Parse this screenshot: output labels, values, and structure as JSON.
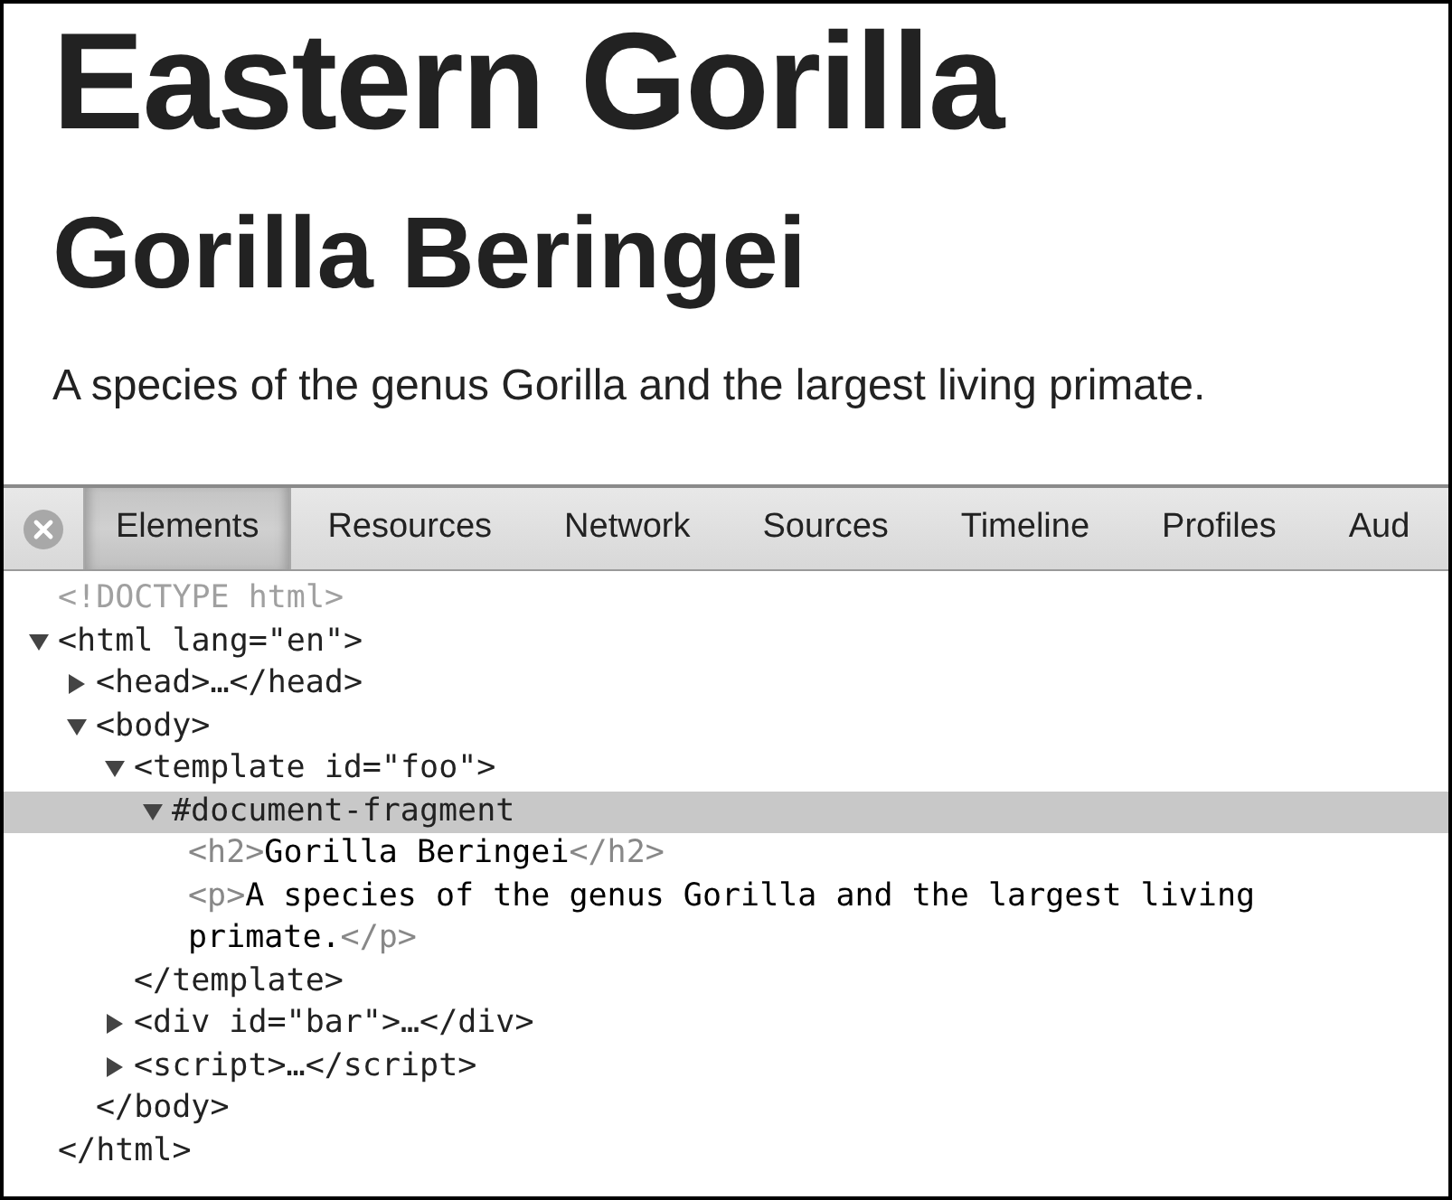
{
  "page": {
    "heading": "Eastern Gorilla",
    "subheading": "Gorilla Beringei",
    "paragraph": "A species of the genus Gorilla and the largest living primate."
  },
  "devtools": {
    "tabs": [
      {
        "label": "Elements",
        "selected": true
      },
      {
        "label": "Resources",
        "selected": false
      },
      {
        "label": "Network",
        "selected": false
      },
      {
        "label": "Sources",
        "selected": false
      },
      {
        "label": "Timeline",
        "selected": false
      },
      {
        "label": "Profiles",
        "selected": false
      },
      {
        "label": "Aud",
        "selected": false
      }
    ],
    "tree": [
      {
        "kind": "doctype",
        "text": "<!DOCTYPE html>",
        "selected": false
      },
      {
        "kind": "tag",
        "text": "<html lang=\"en\">",
        "expanded": true,
        "selected": false,
        "closing": "</html>",
        "children": [
          {
            "kind": "tag",
            "text": "<head>…</head>",
            "expanded": false,
            "selected": false
          },
          {
            "kind": "tag",
            "text": "<body>",
            "expanded": true,
            "selected": false,
            "closing": "</body>",
            "children": [
              {
                "kind": "tag",
                "text": "<template id=\"foo\">",
                "expanded": true,
                "selected": false,
                "closing": "</template>",
                "children": [
                  {
                    "kind": "fragment",
                    "text": "#document-fragment",
                    "expanded": true,
                    "selected": true,
                    "children": [
                      {
                        "kind": "element",
                        "open": "<h2>",
                        "content": "Gorilla Beringei",
                        "close": "</h2>",
                        "selected": false
                      },
                      {
                        "kind": "element",
                        "open": "<p>",
                        "content": "A species of the genus Gorilla and the largest living primate.",
                        "close": "</p>",
                        "selected": false
                      }
                    ]
                  }
                ]
              },
              {
                "kind": "tag",
                "text": "<div id=\"bar\">…</div>",
                "expanded": false,
                "selected": false
              },
              {
                "kind": "tag",
                "text": "<script>…</script>",
                "expanded": false,
                "selected": false
              }
            ]
          }
        ]
      }
    ]
  }
}
